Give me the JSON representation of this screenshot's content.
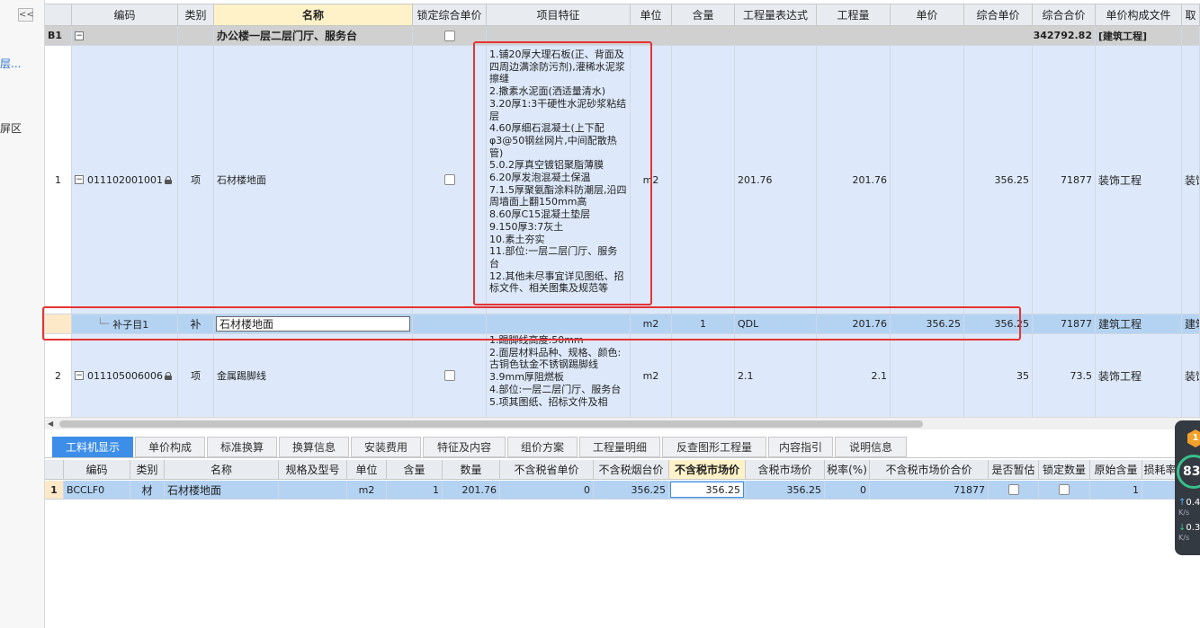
{
  "left_panel": {
    "collapse_label": "<<",
    "link_text": "层...",
    "label_text": "屏区"
  },
  "upper_grid": {
    "columns": [
      "编码",
      "类别",
      "名称",
      "锁定综合单价",
      "项目特征",
      "单位",
      "含量",
      "工程量表达式",
      "工程量",
      "单价",
      "综合单价",
      "综合合价",
      "单价构成文件",
      "取"
    ],
    "group_row": {
      "num": "B1",
      "name": "办公楼一层二层门厅、服务台",
      "total": "342792.82",
      "file": "[建筑工程]"
    },
    "rows": [
      {
        "num": "1",
        "code": "011102001001",
        "type": "项",
        "name": "石材楼地面",
        "features": [
          "1.铺20厚大理石板(正、背面及四周边满涂防污剂),灌稀水泥浆擦缝",
          "2.撒素水泥面(洒适量清水)",
          "3.20厚1:3干硬性水泥砂浆粘结层",
          "4.60厚细石混凝土(上下配φ3@50钢丝网片,中间配散热管)",
          "5.0.2厚真空镀铝聚脂薄膜",
          "6.20厚发泡混凝土保温",
          "7.1.5厚聚氨酯涂料防潮层,沿四周墙面上翻150mm高",
          "8.60厚C15混凝土垫层",
          "9.150厚3:7灰土",
          "10.素土夯实",
          "11.部位:一层二层门厅、服务台",
          "12.其他未尽事宜详见图纸、招标文件、相关图集及规范等"
        ],
        "unit": "m2",
        "content": "",
        "expr": "201.76",
        "qty": "201.76",
        "price": "",
        "unit_total": "356.25",
        "total": "71877",
        "file": "装饰工程",
        "extra": "装饰"
      },
      {
        "num": "",
        "code": "补子目1",
        "type": "补",
        "name": "石材楼地面",
        "features": [],
        "unit": "m2",
        "content": "1",
        "expr": "QDL",
        "qty": "201.76",
        "price": "356.25",
        "unit_total": "356.25",
        "total": "71877",
        "file": "建筑工程",
        "extra": "建筑"
      },
      {
        "num": "2",
        "code": "011105006006",
        "type": "项",
        "name": "金属踢脚线",
        "features": [
          "1.踢脚线高度:50mm",
          "2.面层材料品种、规格、颜色:古铜色钛金不锈钢踢脚线",
          "3.9mm厚阻燃板",
          "4.部位:一层二层门厅、服务台",
          "5.项其图纸、招标文件及相"
        ],
        "unit": "m2",
        "content": "",
        "expr": "2.1",
        "qty": "2.1",
        "price": "",
        "unit_total": "35",
        "total": "73.5",
        "file": "装饰工程",
        "extra": "装饰"
      }
    ]
  },
  "tabs": [
    "工料机显示",
    "单价构成",
    "标准换算",
    "换算信息",
    "安装费用",
    "特征及内容",
    "组价方案",
    "工程量明细",
    "反查图形工程量",
    "内容指引",
    "说明信息"
  ],
  "active_tab": 0,
  "lower_grid": {
    "columns": [
      "编码",
      "类别",
      "名称",
      "规格及型号",
      "单位",
      "含量",
      "数量",
      "不含税省单价",
      "不含税烟台价",
      "不含税市场价",
      "含税市场价",
      "税率(%)",
      "不含税市场价合价",
      "是否暂估",
      "锁定数量",
      "原始含量",
      "损耗率"
    ],
    "rows": [
      {
        "num": "1",
        "code": "BCCLF0",
        "type": "材",
        "name": "石材楼地面",
        "spec": "",
        "unit": "m2",
        "content": "1",
        "qty": "201.76",
        "prov_price": "0",
        "yt_price": "356.25",
        "market_price": "356.25",
        "tax_market_price": "356.25",
        "tax_rate": "0",
        "market_total": "71877",
        "original_content": "1"
      }
    ]
  },
  "widget": {
    "badge": "1",
    "score": "83",
    "up": "0.4",
    "up_unit": "K/s",
    "down": "0.3",
    "down_unit": "K/s"
  },
  "colors": {
    "row_selected": "#b4d3f3",
    "row_item": "#dde9fa",
    "header_highlight": "#fff1c8",
    "tab_active": "#3d8ee8",
    "annotation_red": "#e53333"
  }
}
